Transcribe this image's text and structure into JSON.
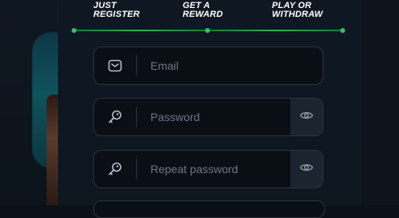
{
  "steps": [
    {
      "line1": "JUST",
      "line2": "REGISTER"
    },
    {
      "line1": "GET A",
      "line2": "REWARD"
    },
    {
      "line1": "PLAY OR",
      "line2": "WITHDRAW"
    }
  ],
  "form": {
    "email": {
      "placeholder": "Email",
      "icon": "envelope-icon"
    },
    "password": {
      "placeholder": "Password",
      "icon": "key-icon",
      "toggle_icon": "eye-icon"
    },
    "repeat_password": {
      "placeholder": "Repeat password",
      "icon": "key-icon",
      "toggle_icon": "eye-icon"
    }
  },
  "colors": {
    "accent": "#36c467",
    "panel": "#0f1822",
    "field_bg": "#0a0f16",
    "field_border": "#2a3340",
    "placeholder": "#6d7785"
  }
}
